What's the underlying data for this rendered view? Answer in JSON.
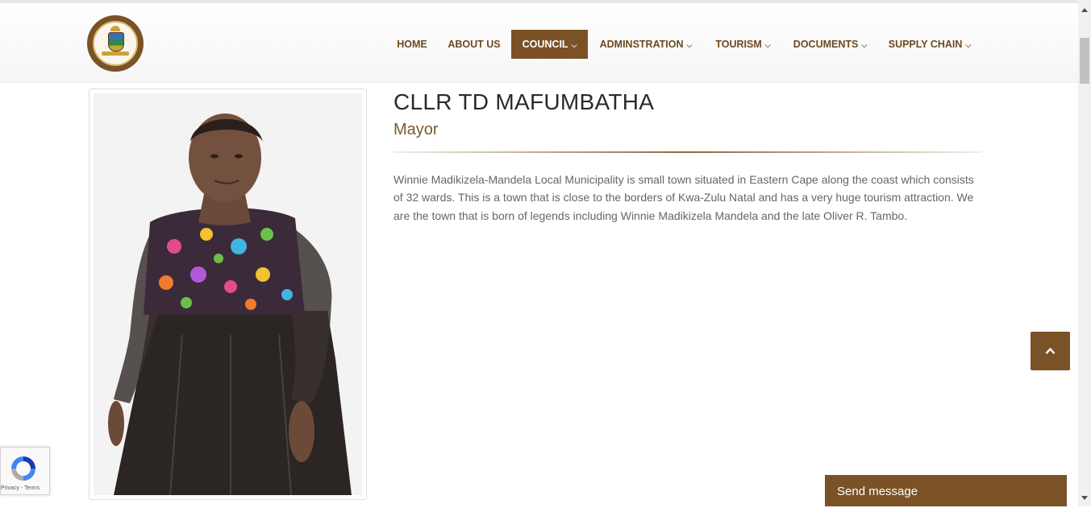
{
  "header": {
    "logo_icon": "municipality-crest-icon"
  },
  "nav": {
    "items": [
      {
        "label": "HOME",
        "has_dropdown": false
      },
      {
        "label": "ABOUT US",
        "has_dropdown": false
      },
      {
        "label": "COUNCIL",
        "has_dropdown": true,
        "active": true
      },
      {
        "label": "ADMINSTRATION",
        "has_dropdown": true
      },
      {
        "label": "TOURISM",
        "has_dropdown": true
      },
      {
        "label": "DOCUMENTS",
        "has_dropdown": true
      },
      {
        "label": "SUPPLY CHAIN",
        "has_dropdown": true
      }
    ],
    "dropdown_icon": "⌄"
  },
  "profile": {
    "name": "CLLR TD MAFUMBATHA",
    "role": "Mayor",
    "bio": "Winnie Madikizela-Mandela Local Municipality is small town situated in Eastern Cape along the coast which consists of 32 wards. This is a town that is close to the borders of Kwa-Zulu Natal and has a very huge tourism attraction. We are the town that is born of legends including Winnie Madikizela Mandela and the late Oliver R. Tambo."
  },
  "widgets": {
    "send_message": "Send message",
    "recaptcha_links": "Privacy - Terms",
    "back_to_top_icon": "chevron-up-icon"
  },
  "colors": {
    "brand": "#7b5226",
    "text": "#666666",
    "heading": "#2a2a2a",
    "role": "#7b5a2e"
  }
}
